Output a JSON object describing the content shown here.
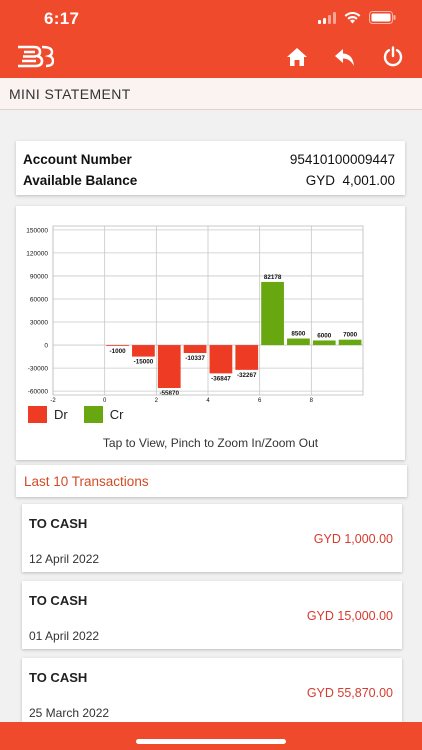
{
  "status_bar": {
    "time": "6:17"
  },
  "header": {
    "logo_icon": "bank-logo-icon",
    "actions": [
      {
        "name": "home-icon"
      },
      {
        "name": "back-icon"
      },
      {
        "name": "power-icon"
      }
    ]
  },
  "page": {
    "title": "MINI STATEMENT"
  },
  "account": {
    "number_label": "Account Number",
    "number_value": "95410100009447",
    "balance_label": "Available Balance",
    "balance_value": "GYD  4,001.00"
  },
  "chart_data": {
    "type": "bar",
    "x_ticks": [
      "-2",
      "0",
      "2",
      "4",
      "6",
      "8"
    ],
    "y_ticks": [
      "150000",
      "120000",
      "90000",
      "60000",
      "30000",
      "0",
      "-30000",
      "-60000"
    ],
    "ylim": [
      -65000,
      155000
    ],
    "xlim": [
      -2,
      10
    ],
    "grid": true,
    "series": [
      {
        "name": "Dr",
        "color": "#ee3b24",
        "points": [
          {
            "x": 0,
            "y": -1000
          },
          {
            "x": 1,
            "y": -15000
          },
          {
            "x": 2,
            "y": -55870
          },
          {
            "x": 3,
            "y": -10337
          },
          {
            "x": 4,
            "y": -36847
          },
          {
            "x": 5,
            "y": -32267
          }
        ]
      },
      {
        "name": "Cr",
        "color": "#68a70f",
        "points": [
          {
            "x": 6,
            "y": 82178
          },
          {
            "x": 7,
            "y": 8500
          },
          {
            "x": 8,
            "y": 6000
          },
          {
            "x": 9,
            "y": 7000
          }
        ]
      }
    ],
    "legend": [
      "Dr",
      "Cr"
    ],
    "legend_position": "bottom-left"
  },
  "chart_hint": "Tap to View, Pinch to Zoom In/Zoom Out",
  "transactions_title": "Last 10 Transactions",
  "transactions": [
    {
      "description": "TO CASH",
      "amount": "GYD 1,000.00",
      "date": "12 April 2022"
    },
    {
      "description": "TO CASH",
      "amount": "GYD 15,000.00",
      "date": "01 April 2022"
    },
    {
      "description": "TO CASH",
      "amount": "GYD 55,870.00",
      "date": "25 March 2022"
    }
  ],
  "colors": {
    "brand": "#f04a2d",
    "debit": "#ee3b24",
    "credit": "#68a70f",
    "amount_text": "#d63b2f"
  }
}
